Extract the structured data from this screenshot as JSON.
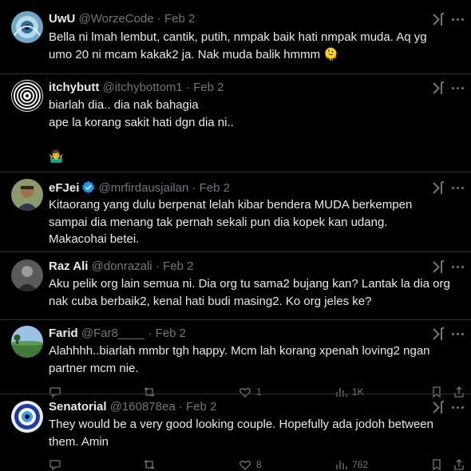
{
  "replies": [
    {
      "name": "UwU",
      "handle": "@WorzeCode",
      "date": "Feb 2",
      "avatar": "eye-art-avatar",
      "lines": [
        "Bella ni lmah lembut, cantik, putih, nmpak baik hati nmpak muda. Aq yg umo 20 ni mcam kakak2 ja. Nak muda balik hmmm 🫠"
      ]
    },
    {
      "name": "itchybutt",
      "handle": "@itchybottom1",
      "date": "Feb 2",
      "avatar": "swirl-pattern-avatar",
      "lines": [
        "biarlah dia.. dia nak bahagia",
        "ape la korang sakit hati dgn dia ni..",
        "",
        "🤷‍♂️"
      ]
    },
    {
      "name": "eFJei",
      "handle": "@mrfirdausjailan",
      "date": "Feb 2",
      "avatar": "man-photo-avatar",
      "lines": [
        "Kitaorang yang dulu berpenat lelah kibar bendera MUDA berkempen sampai dia menang tak pernah sekali pun dia kopek kan udang. Makacohai betei."
      ]
    },
    {
      "name": "Raz Ali",
      "handle": "@donrazali",
      "date": "Feb 2",
      "avatar": "grey-photo-avatar",
      "lines": [
        "Aku pelik org lain semua ni. Dia org tu sama2 bujang kan? Lantak la dia org nak cuba berbaik2, kenal hati budi masing2. Ko org jeles ke?"
      ]
    },
    {
      "name": "Farid",
      "handle": "@Far8____",
      "date": "Feb 2",
      "avatar": "field-photo-avatar",
      "lines": [
        "Alahhhh..biarlah mmbr tgh happy. Mcm lah korang xpenah loving2 ngan partner mcm nie."
      ],
      "stats": {
        "likes": "1",
        "views": "1K"
      }
    },
    {
      "name": "Senatorial",
      "handle": "@160878ea",
      "date": "Feb 2",
      "avatar": "blue-eye-avatar",
      "lines": [
        "They would be a very good looking couple. Hopefully ada jodoh between them. Amin"
      ],
      "stats": {
        "likes": "8",
        "views": "762"
      }
    }
  ],
  "separator": "·",
  "colors": {
    "background": "#000000",
    "text": "#e7e9ea",
    "muted": "#71767b",
    "verified": "#1d9bf0",
    "divider": "#2f3336"
  }
}
